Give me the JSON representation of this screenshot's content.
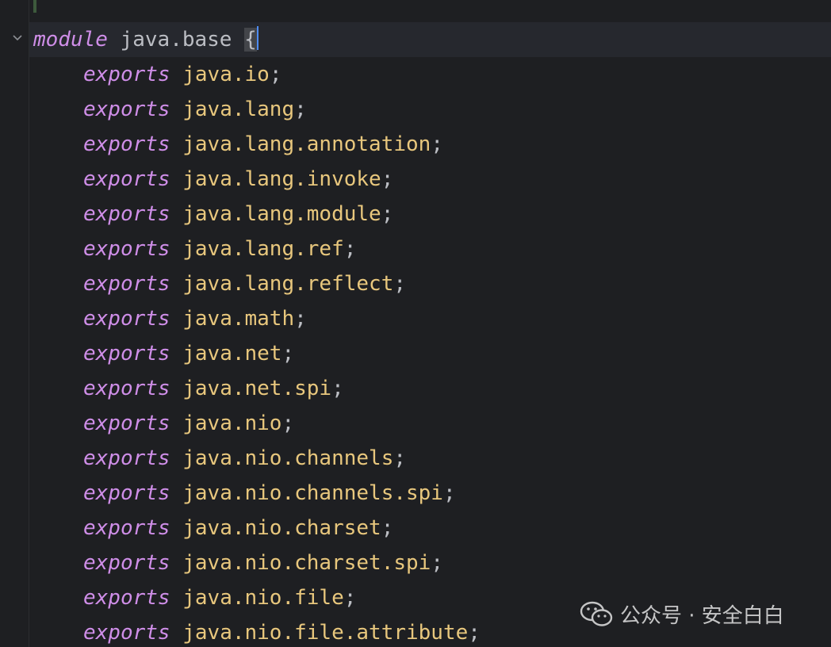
{
  "editor": {
    "module_line": {
      "keyword": "module",
      "name": "java.base",
      "brace": "{"
    },
    "export_keyword": "exports",
    "exports": [
      "java.io",
      "java.lang",
      "java.lang.annotation",
      "java.lang.invoke",
      "java.lang.module",
      "java.lang.ref",
      "java.lang.reflect",
      "java.math",
      "java.net",
      "java.net.spi",
      "java.nio",
      "java.nio.channels",
      "java.nio.channels.spi",
      "java.nio.charset",
      "java.nio.charset.spi",
      "java.nio.file",
      "java.nio.file.attribute"
    ],
    "terminator": ";",
    "colors": {
      "background": "#1e1f22",
      "keyword": "#cf8ee8",
      "package": "#e8c77d",
      "punctuation": "#bcbec4",
      "caret": "#4e8cf5"
    }
  },
  "watermark": {
    "icon": "wechat-icon",
    "text": "公众号 · 安全白白"
  }
}
